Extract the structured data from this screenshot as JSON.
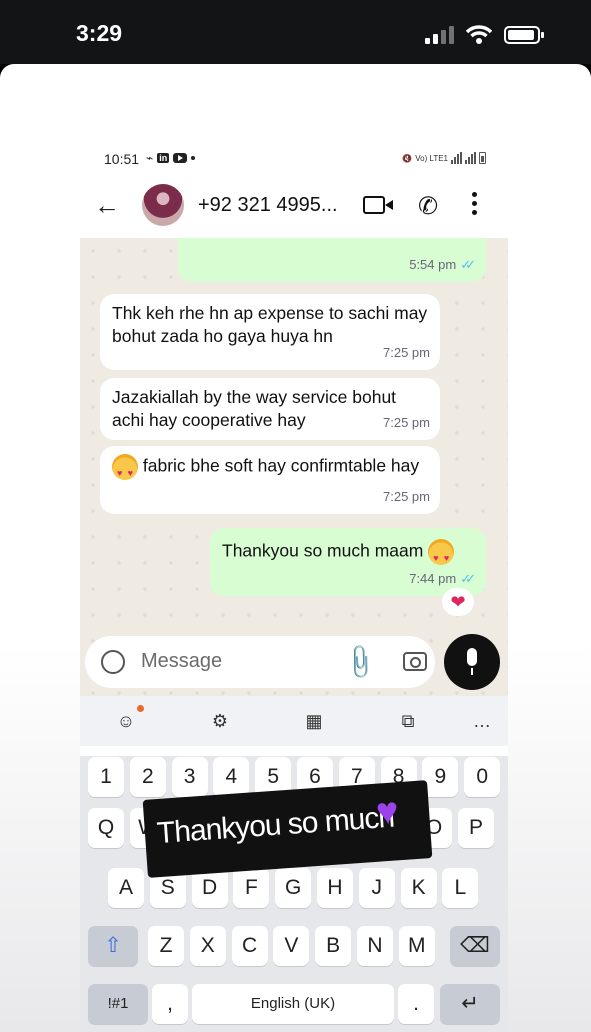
{
  "ios_status": {
    "time": "3:29"
  },
  "android_status": {
    "time": "10:51",
    "app_icons": [
      "in"
    ],
    "right_label": "Vo) LTE1"
  },
  "header": {
    "contact": "+92 321 4995..."
  },
  "messages": [
    {
      "direction": "out",
      "text": "",
      "time": "5:54 pm",
      "read": true
    },
    {
      "direction": "in",
      "text": "Thk keh rhe hn ap expense to sachi may bohut zada ho gaya huya hn",
      "time": "7:25 pm"
    },
    {
      "direction": "in",
      "text": "Jazakiallah by the way service bohut achi hay cooperative hay",
      "time": "7:25 pm"
    },
    {
      "direction": "in",
      "emoji": "smiling-face-with-hearts",
      "text": "fabric bhe soft hay confirmtable hay",
      "time": "7:25 pm"
    },
    {
      "direction": "out",
      "text": "Thankyou so much maam",
      "emoji": "smiling-face-with-hearts",
      "time": "7:44 pm",
      "read": true,
      "reaction": "❤"
    }
  ],
  "composer": {
    "placeholder": "Message"
  },
  "keyboard": {
    "number_row": [
      "1",
      "2",
      "3",
      "4",
      "5",
      "6",
      "7",
      "8",
      "9",
      "0"
    ],
    "row1_visible": [
      "Q",
      "W",
      "O",
      "P"
    ],
    "row2": [
      "A",
      "S",
      "D",
      "F",
      "G",
      "H",
      "J",
      "K",
      "L"
    ],
    "row3": [
      "Z",
      "X",
      "C",
      "V",
      "B",
      "N",
      "M"
    ],
    "symbols": "!#1",
    "comma": ",",
    "space": "English (UK)",
    "period": "."
  },
  "story_overlay": {
    "text": "Thankyou so much",
    "heart_color": "#9b43e8"
  },
  "colors": {
    "incoming": "#ffffff",
    "outgoing": "#d9fdd3",
    "chat_bg": "#efeae2",
    "read_ticks": "#53bdeb"
  }
}
